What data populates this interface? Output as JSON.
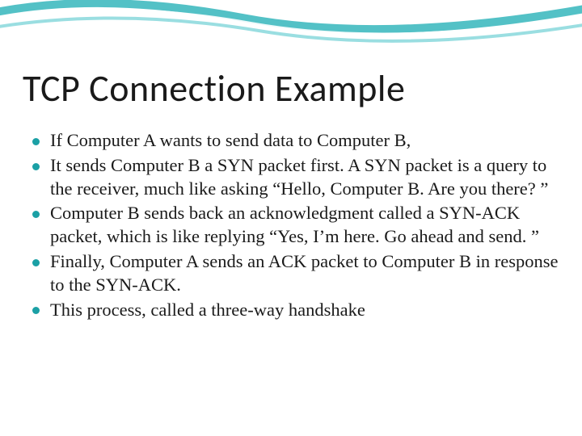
{
  "slide": {
    "title": "TCP Connection Example",
    "bullets": [
      "If Computer A wants to send data to Computer B,",
      "It sends Computer B a SYN packet first. A SYN packet is a query to the receiver, much like asking “Hello, Computer B. Are you there? ”",
      "Computer B sends back an acknowledgment called a SYN-ACK packet, which is like replying “Yes, I’m here. Go ahead and send. ”",
      "Finally, Computer A sends an ACK packet to Computer B in response to the SYN-ACK.",
      "This process, called a three-way handshake"
    ]
  },
  "theme": {
    "accent": "#1ba0a5",
    "swoosh_teal": "#35b6bc",
    "swoosh_white": "#ffffff"
  }
}
